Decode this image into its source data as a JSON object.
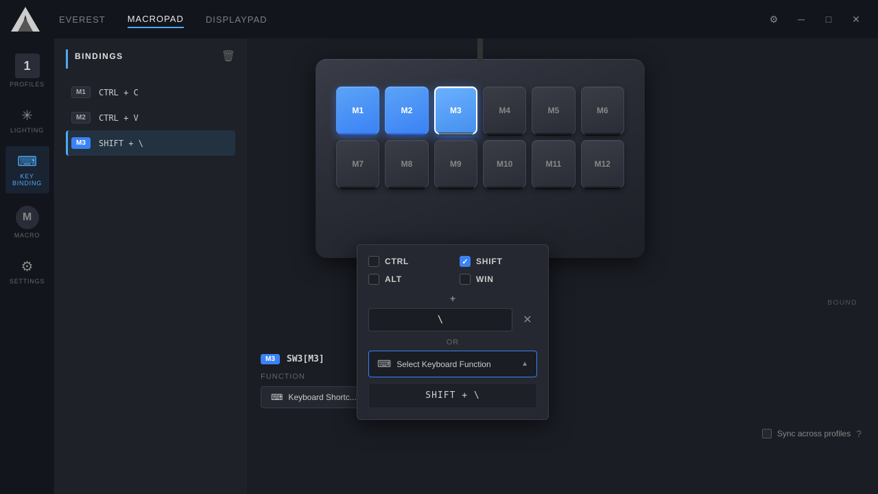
{
  "titlebar": {
    "logo_alt": "Logo",
    "nav_items": [
      {
        "id": "everest",
        "label": "EVEREST",
        "active": false
      },
      {
        "id": "macropad",
        "label": "MACROPAD",
        "active": true
      },
      {
        "id": "displaypad",
        "label": "DISPLAYPAD",
        "active": false
      }
    ],
    "controls": {
      "settings_label": "⚙",
      "minimize_label": "─",
      "maximize_label": "□",
      "close_label": "✕"
    }
  },
  "sidebar": {
    "items": [
      {
        "id": "profiles",
        "label": "PROFILES",
        "icon": "1",
        "active": false
      },
      {
        "id": "lighting",
        "label": "LIGHTING",
        "icon": "✳",
        "active": false
      },
      {
        "id": "key-binding",
        "label": "KEY BINDING",
        "icon": "⌨",
        "active": true
      },
      {
        "id": "macro",
        "label": "MACRO",
        "icon": "M",
        "active": false
      },
      {
        "id": "settings",
        "label": "SETTINGS",
        "icon": "⚙",
        "active": false
      }
    ]
  },
  "bindings": {
    "title": "BINDINGS",
    "items": [
      {
        "key": "M1",
        "value": "CTRL + C",
        "active": false
      },
      {
        "key": "M2",
        "value": "CTRL + V",
        "active": false
      },
      {
        "key": "M3",
        "value": "SHIFT + \\",
        "active": true
      }
    ]
  },
  "macropad": {
    "keys_row1": [
      {
        "id": "M1",
        "label": "M1",
        "state": "lit"
      },
      {
        "id": "M2",
        "label": "M2",
        "state": "lit"
      },
      {
        "id": "M3",
        "label": "M3",
        "state": "selected"
      },
      {
        "id": "M4",
        "label": "M4",
        "state": "normal"
      },
      {
        "id": "M5",
        "label": "M5",
        "state": "normal"
      },
      {
        "id": "M6",
        "label": "M6",
        "state": "normal"
      }
    ],
    "keys_row2": [
      {
        "id": "M7",
        "label": "M7",
        "state": "normal"
      },
      {
        "id": "M8",
        "label": "M8",
        "state": "normal"
      },
      {
        "id": "M9",
        "label": "M9",
        "state": "normal"
      },
      {
        "id": "M10",
        "label": "M10",
        "state": "normal"
      },
      {
        "id": "M11",
        "label": "M11",
        "state": "normal"
      },
      {
        "id": "M12",
        "label": "M12",
        "state": "normal"
      }
    ]
  },
  "bound_label": "BOUND",
  "key_info": {
    "key_badge": "M3",
    "sw_label": "SW3[M3]",
    "function_label": "FUNCTION",
    "function_value": "Keyboard Shortc...",
    "function_icon": "⌨"
  },
  "modifier_popup": {
    "ctrl_label": "CTRL",
    "ctrl_checked": false,
    "shift_label": "SHIFT",
    "shift_checked": true,
    "alt_label": "ALT",
    "alt_checked": false,
    "win_label": "WIN",
    "win_checked": false,
    "plus_symbol": "+",
    "key_value": "\\",
    "or_label": "OR",
    "select_keyboard_label": "Select Keyboard Function",
    "dropdown_arrow": "▲",
    "result_value": "SHIFT + \\"
  },
  "sync": {
    "label": "Sync across profiles",
    "info_icon": "?"
  }
}
